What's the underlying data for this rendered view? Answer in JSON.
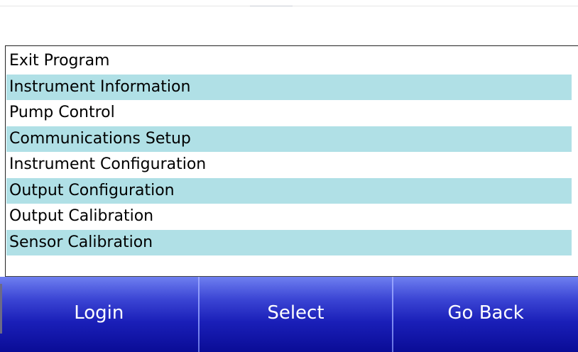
{
  "menu": {
    "items": [
      {
        "label": "Exit Program"
      },
      {
        "label": "Instrument Information"
      },
      {
        "label": "Pump Control"
      },
      {
        "label": "Communications Setup"
      },
      {
        "label": "Instrument Configuration"
      },
      {
        "label": "Output Configuration"
      },
      {
        "label": "Output Calibration"
      },
      {
        "label": "Sensor Calibration"
      }
    ],
    "alt_row_color": "#b0e0e6"
  },
  "buttons": {
    "login_label": "Login",
    "select_label": "Select",
    "go_back_label": "Go Back",
    "color": "#1a1fb8"
  }
}
